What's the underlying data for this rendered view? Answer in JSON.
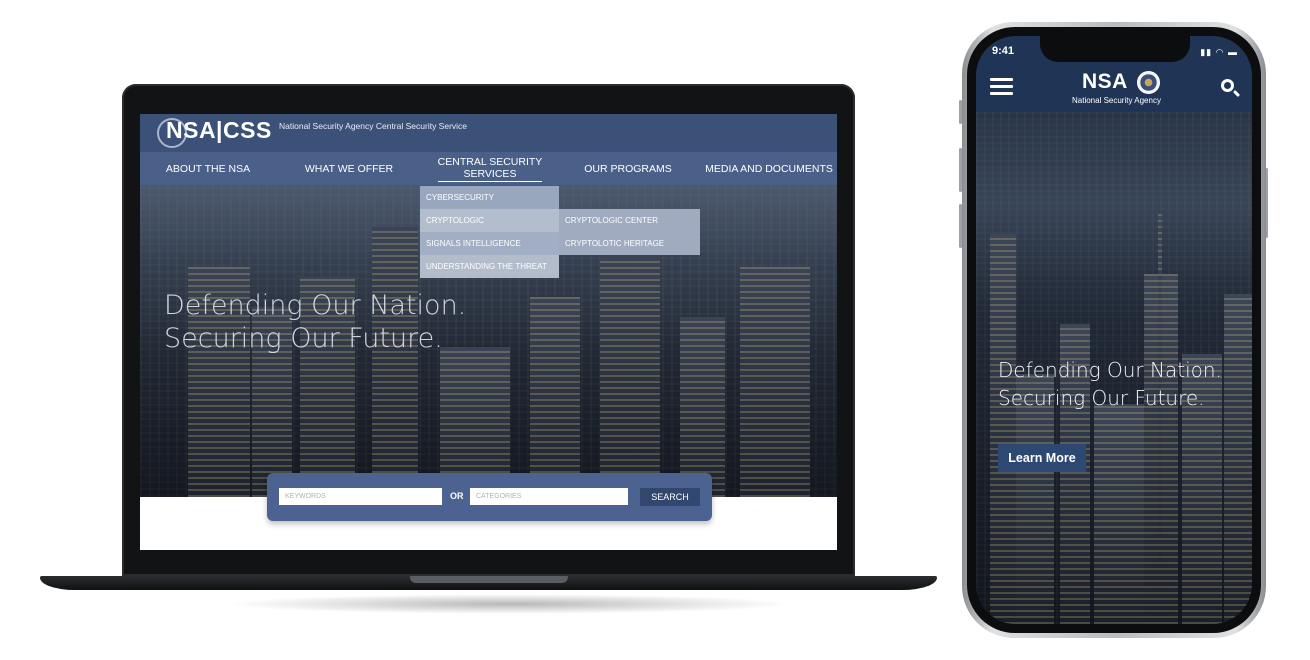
{
  "desktop": {
    "logo": "NSA|CSS",
    "tagline": "National Security Agency Central Security Service",
    "nav": [
      {
        "label": "ABOUT THE NSA"
      },
      {
        "label": "WHAT WE OFFER"
      },
      {
        "label": "CENTRAL SECURITY\nSERVICES"
      },
      {
        "label": "OUR PROGRAMS"
      },
      {
        "label": "MEDIA AND DOCUMENTS"
      }
    ],
    "dropdown": {
      "items": [
        "CYBERSECURITY",
        "CRYPTOLOGIC",
        "SIGNALS INTELLIGENCE",
        "UNDERSTANDING THE THREAT"
      ],
      "submenu": [
        "CRYPTOLOGIC CENTER",
        "CRYPTOLOTIC HERITAGE"
      ]
    },
    "hero": {
      "line1": "Defending Our Nation.",
      "line2": "Securing Our Future."
    },
    "search": {
      "keywords_placeholder": "KEYWORDS",
      "or_label": "OR",
      "categories_placeholder": "CATEGORIES",
      "button_label": "SEARCH"
    }
  },
  "mobile": {
    "status_time": "9:41",
    "logo": "NSA",
    "logo_sub": "National Security Agency",
    "hero": {
      "line1": "Defending Our Nation.",
      "line2": "Securing Our Future."
    },
    "cta_label": "Learn More"
  },
  "colors": {
    "header_navy": "#3c5178",
    "nav_blue": "#4a6089",
    "search_panel": "#4c6290",
    "mobile_header": "#203455",
    "cta": "#2e4874"
  }
}
